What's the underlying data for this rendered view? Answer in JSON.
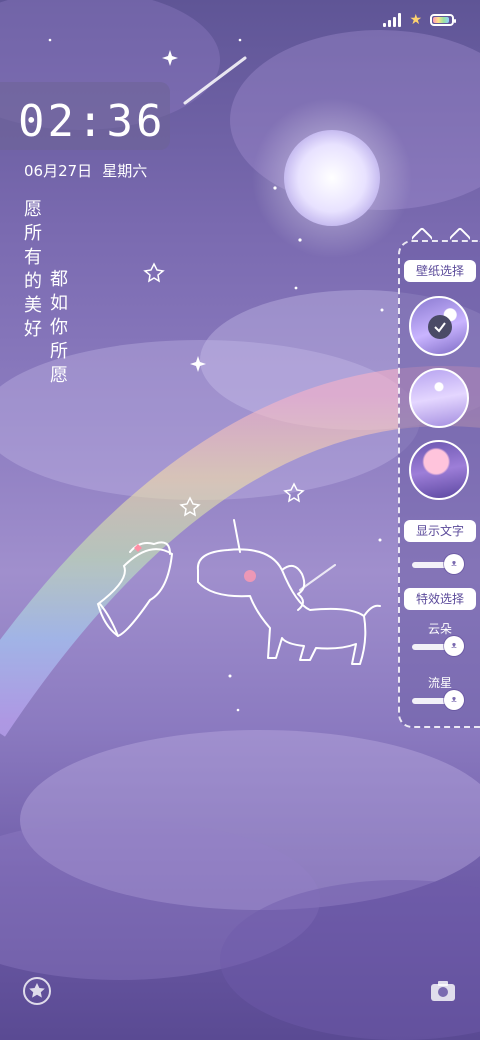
{
  "status_bar": {
    "signal_bars": 4,
    "battery_level": 0.8
  },
  "lockscreen": {
    "time": "02:36",
    "date": "06月27日",
    "weekday": "星期六",
    "poem_col1": [
      "愿",
      "所",
      "有",
      "的",
      "美",
      "好"
    ],
    "poem_col2": [
      "都",
      "如",
      "你",
      "所",
      "愿"
    ]
  },
  "panel": {
    "wallpaper_title": "壁纸选择",
    "show_text_title": "显示文字",
    "effects_title": "特效选择",
    "cloud_label": "云朵",
    "meteor_label": "流星"
  },
  "colors": {
    "accent": "#5b4a9a",
    "panel_bg": "#6e5fa5"
  },
  "icons": {
    "left_bottom": "star-circle-icon",
    "right_bottom": "camera-icon"
  }
}
